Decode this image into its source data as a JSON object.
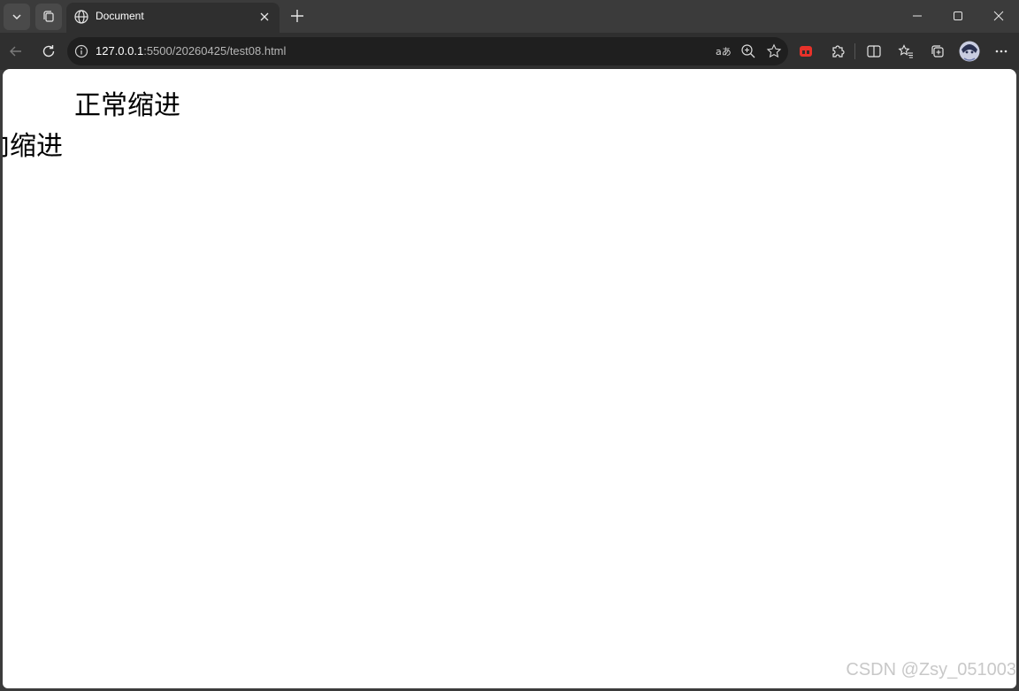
{
  "browser": {
    "tab": {
      "title": "Document"
    },
    "address": {
      "host": "127.0.0.1",
      "rest": ":5500/20260425/test08.html"
    }
  },
  "page": {
    "line1": "正常缩进",
    "line2": "向缩进"
  },
  "watermark": "CSDN @Zsy_051003",
  "icons": [
    "tab-list-icon",
    "collections-icon",
    "globe-icon",
    "close-icon",
    "plus-icon",
    "minimize-icon",
    "maximize-icon",
    "window-close-icon",
    "back-icon",
    "refresh-icon",
    "info-icon",
    "read-aloud-icon",
    "zoom-icon",
    "star-icon",
    "extension-red-icon",
    "puzzle-icon",
    "split-screen-icon",
    "favorites-icon",
    "collections-add-icon",
    "profile-avatar",
    "more-icon"
  ]
}
